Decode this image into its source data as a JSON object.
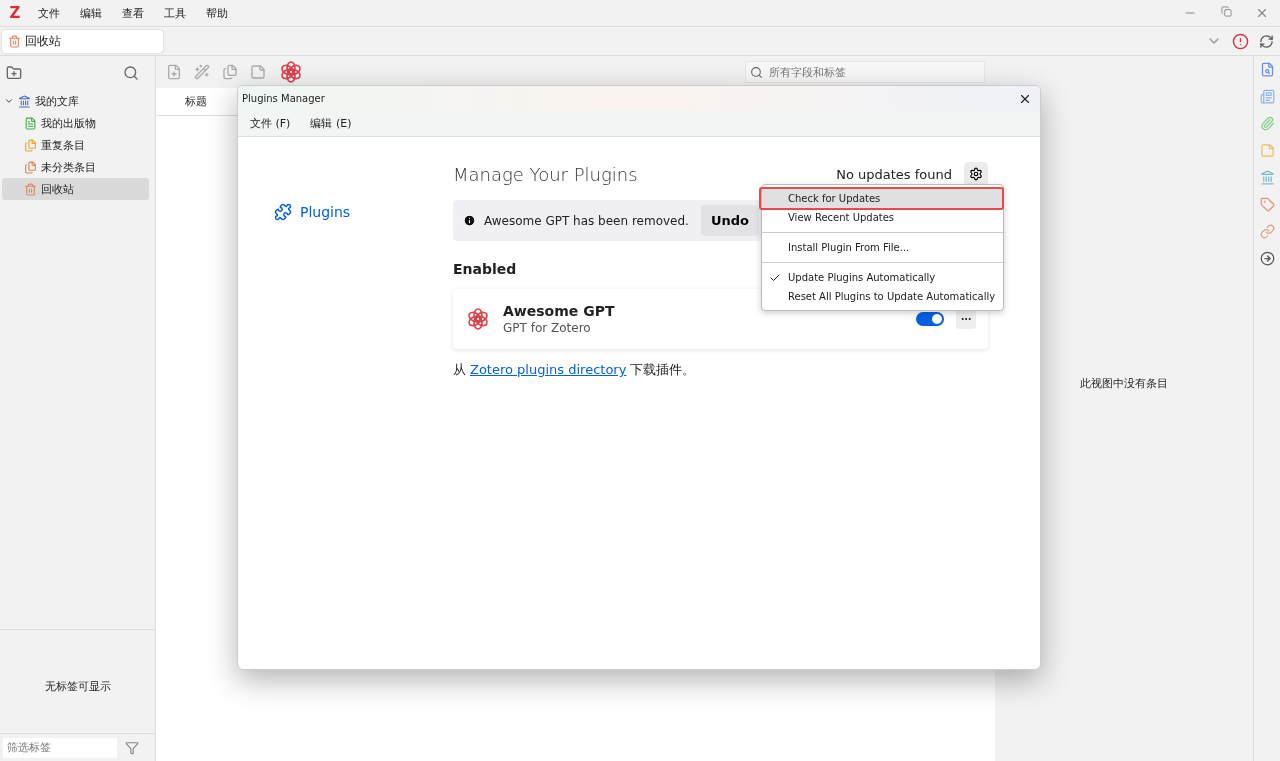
{
  "menu_bar": {
    "logo": "Z",
    "items": [
      "文件",
      "编辑",
      "查看",
      "工具",
      "帮助"
    ]
  },
  "tabs": [
    {
      "label": "回收站",
      "selected": true
    }
  ],
  "collections": [
    {
      "label": "我的文库",
      "selected": false,
      "expanded": true,
      "children": [
        {
          "label": "我的出版物",
          "selected": false
        },
        {
          "label": "重复条目",
          "selected": false
        },
        {
          "label": "未分类条目",
          "selected": false
        },
        {
          "label": "回收站",
          "selected": true
        }
      ]
    }
  ],
  "tag_selector": {
    "message": "无标签可显示",
    "filter_placeholder": "筛选标签"
  },
  "items_pane": {
    "search_placeholder": "所有字段和标签",
    "columns": [
      "标题"
    ]
  },
  "item_pane": {
    "message": "此视图中没有条目"
  },
  "dialog": {
    "title": "Plugins Manager",
    "menus": [
      "文件 (F)",
      "编辑 (E)"
    ],
    "nav": [
      {
        "label": "Plugins",
        "selected": true
      }
    ],
    "heading": "Manage Your Plugins",
    "update_status": "No updates found",
    "notice": {
      "message": "Awesome GPT has been removed.",
      "action": "Undo"
    },
    "section": "Enabled",
    "plugins": [
      {
        "name": "Awesome GPT",
        "description": "GPT for Zotero",
        "enabled": true
      }
    ],
    "footer": {
      "before": "从",
      "link": "Zotero plugins directory",
      "after": "下载插件。"
    },
    "gear_menu": [
      {
        "label": "Check for Updates",
        "kind": "item",
        "highlighted": true,
        "checked": false
      },
      {
        "label": "View Recent Updates",
        "kind": "item",
        "highlighted": false,
        "checked": false
      },
      {
        "kind": "separator"
      },
      {
        "label": "Install Plugin From File...",
        "kind": "item",
        "highlighted": false,
        "checked": false
      },
      {
        "kind": "separator"
      },
      {
        "label": "Update Plugins Automatically",
        "kind": "item",
        "highlighted": false,
        "checked": true
      },
      {
        "label": "Reset All Plugins to Update Automatically",
        "kind": "item",
        "highlighted": false,
        "checked": false
      }
    ]
  }
}
